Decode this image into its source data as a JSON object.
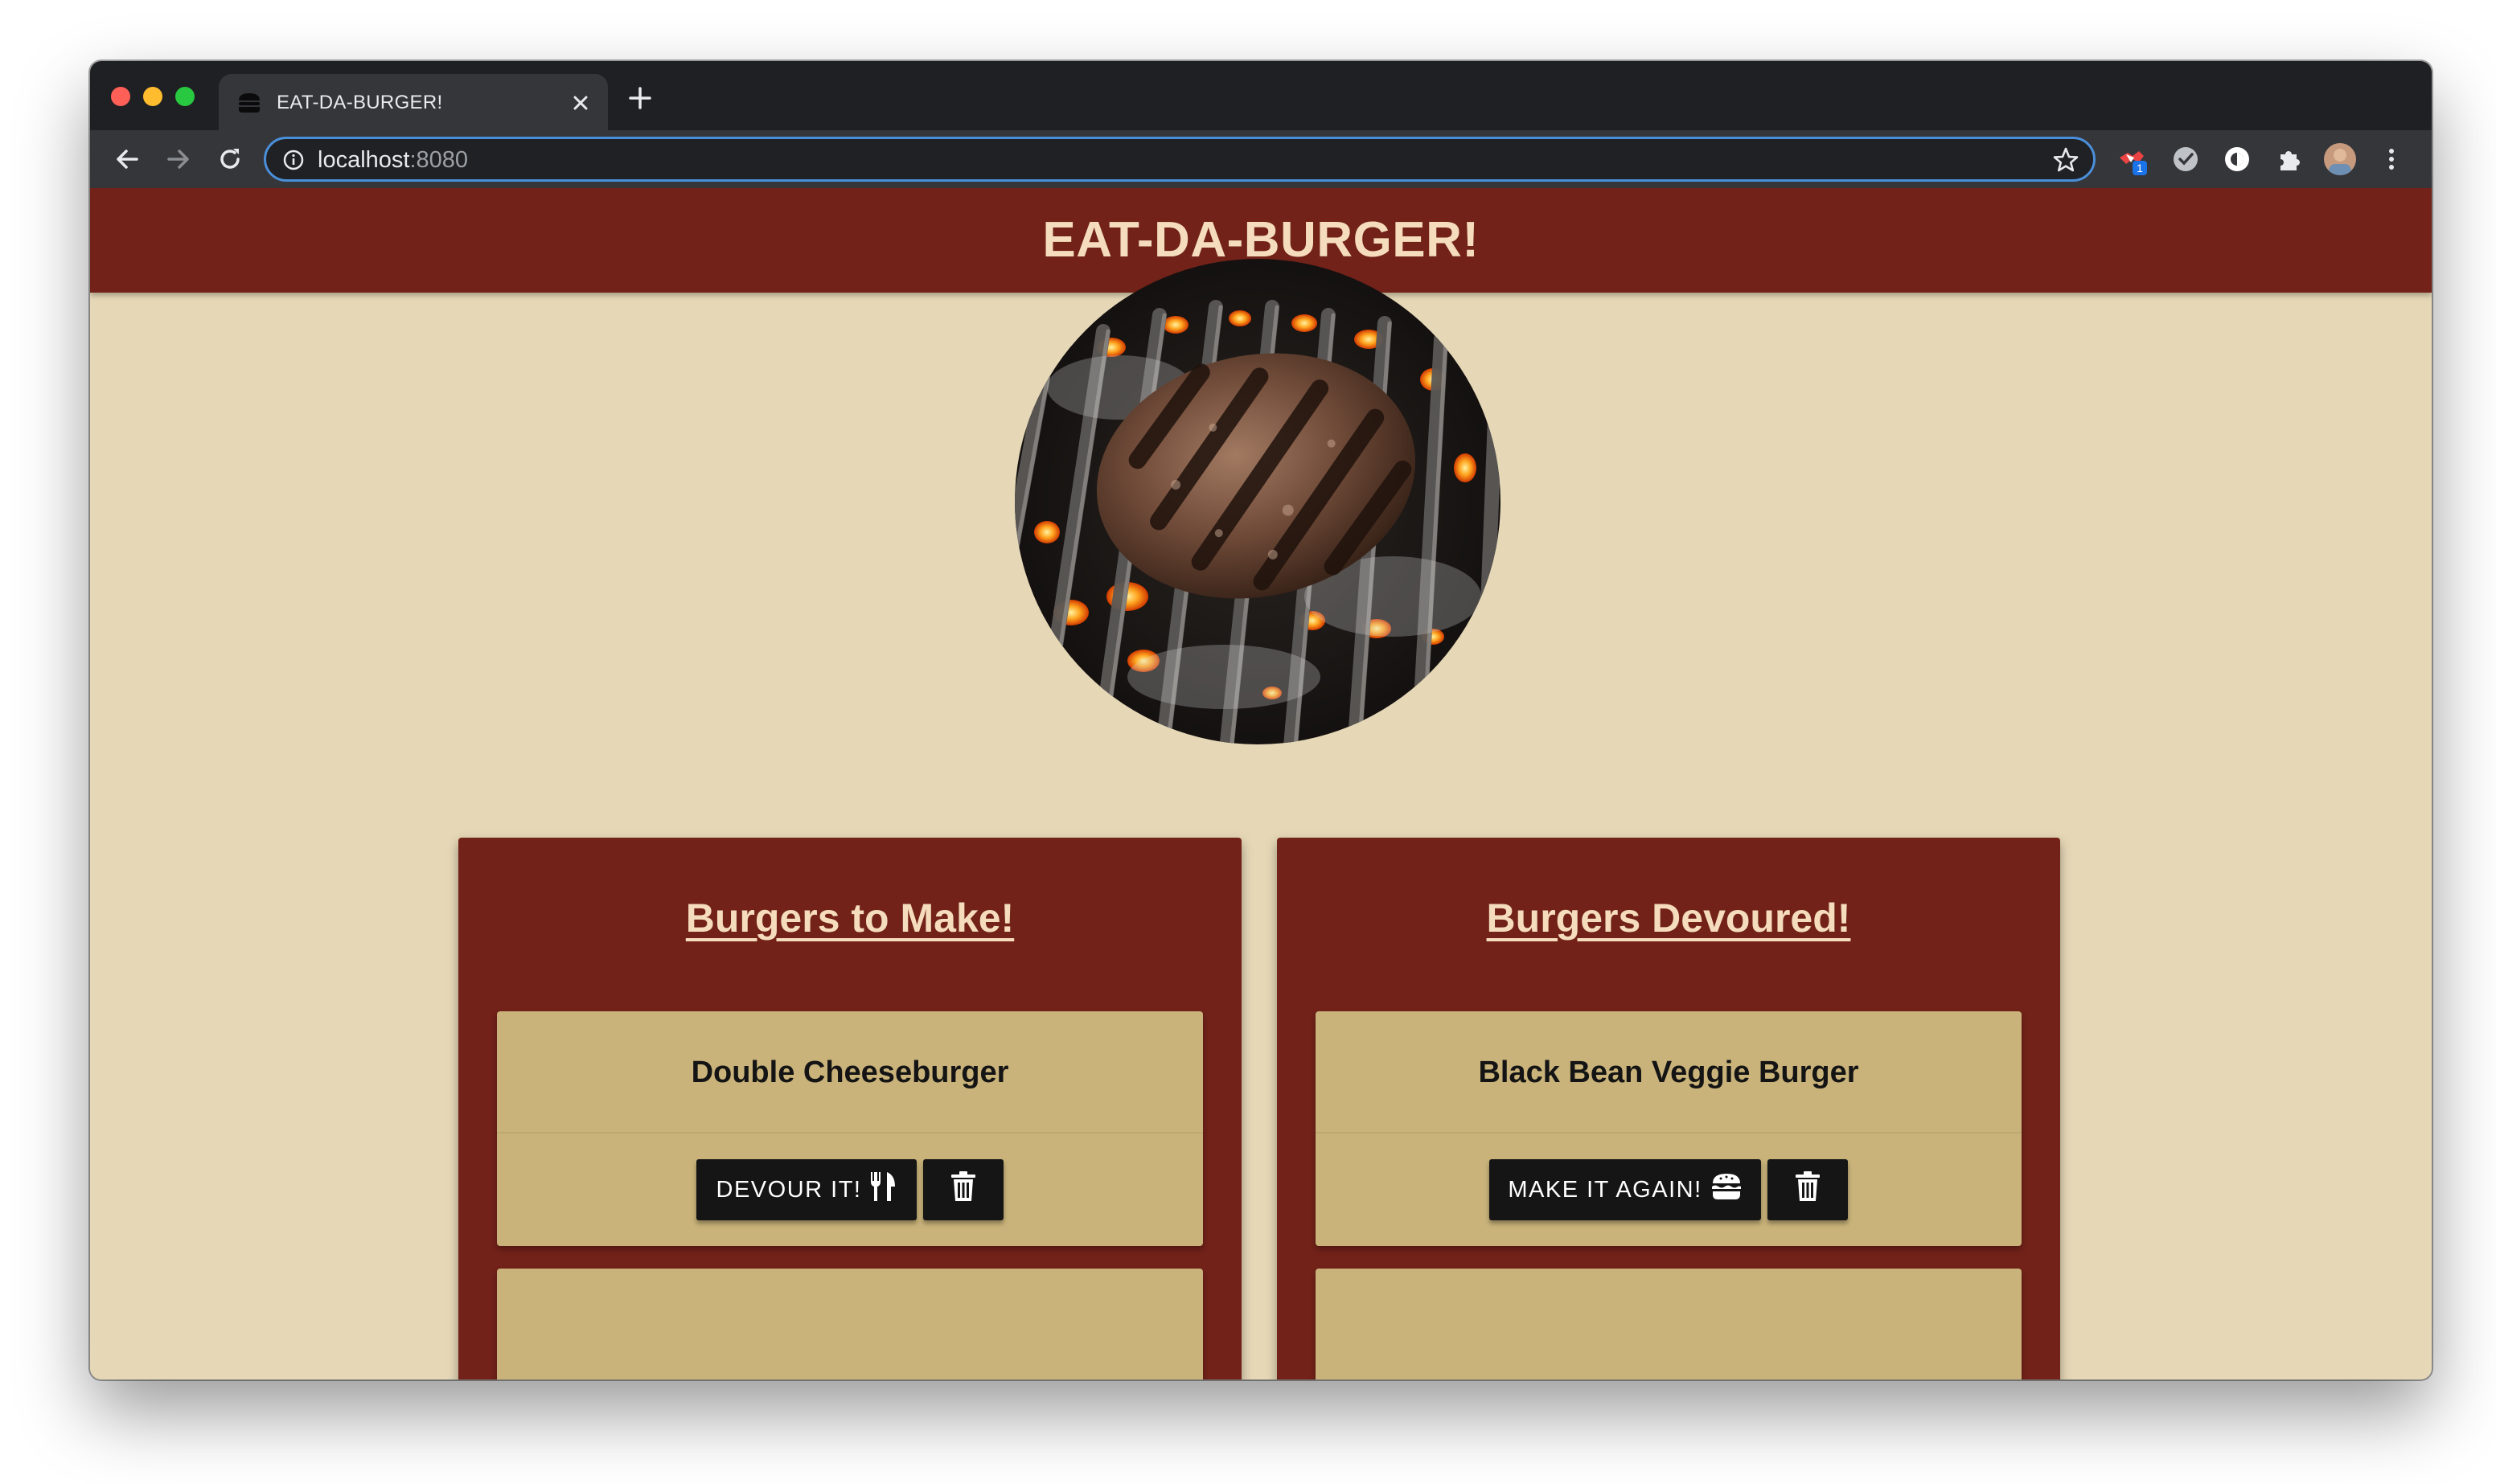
{
  "browser": {
    "tab_title": "EAT-DA-BURGER!",
    "url_host": "localhost",
    "url_port": ":8080",
    "extension_badge": "1"
  },
  "header": {
    "title": "EAT-DA-BURGER!"
  },
  "colors": {
    "brand_red": "#722219",
    "page_bg": "#e6d8b7",
    "card_bg": "#c9b37a",
    "title_text": "#f5dcbc",
    "button_bg": "#151515"
  },
  "hero": {
    "image": "grilling-burger-patty"
  },
  "panels": {
    "to_make": {
      "title": "Burgers to Make!",
      "items": [
        {
          "name": "Double Cheeseburger",
          "action_label": "DEVOUR IT!",
          "action_icon": "utensils-icon",
          "delete_icon": "trash-icon"
        }
      ]
    },
    "devoured": {
      "title": "Burgers Devoured!",
      "items": [
        {
          "name": "Black Bean Veggie Burger",
          "action_label": "MAKE IT AGAIN!",
          "action_icon": "hamburger-icon",
          "delete_icon": "trash-icon"
        }
      ]
    }
  }
}
